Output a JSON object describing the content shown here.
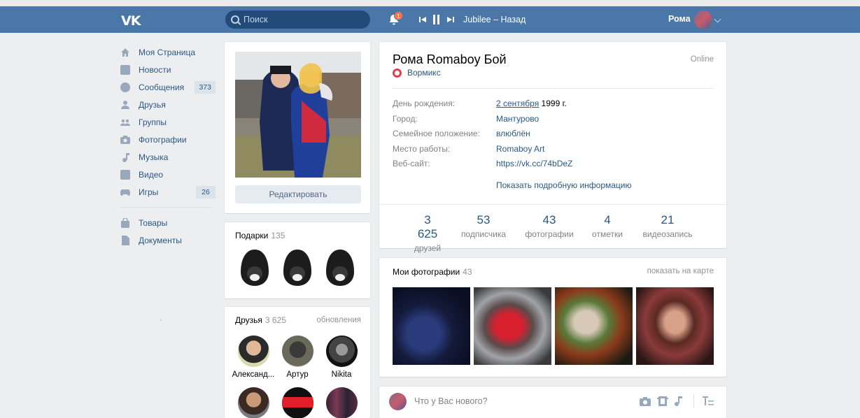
{
  "header": {
    "logo": "VK",
    "search_placeholder": "Поиск",
    "notifications_count": "1",
    "track": "Jubilee – Назад",
    "user_name": "Рома"
  },
  "sidebar": {
    "items": [
      {
        "label": "Моя Страница",
        "icon": "home-icon"
      },
      {
        "label": "Новости",
        "icon": "news-icon"
      },
      {
        "label": "Сообщения",
        "icon": "messages-icon",
        "count": "373"
      },
      {
        "label": "Друзья",
        "icon": "friend-icon"
      },
      {
        "label": "Группы",
        "icon": "groups-icon"
      },
      {
        "label": "Фотографии",
        "icon": "camera-icon"
      },
      {
        "label": "Музыка",
        "icon": "music-icon"
      },
      {
        "label": "Видео",
        "icon": "video-icon"
      },
      {
        "label": "Игры",
        "icon": "games-icon",
        "count": "26"
      }
    ],
    "extra": [
      {
        "label": "Товары",
        "icon": "bag-icon"
      },
      {
        "label": "Документы",
        "icon": "document-icon"
      }
    ]
  },
  "avatar_card": {
    "edit_label": "Редактировать"
  },
  "gifts": {
    "title": "Подарки",
    "count": "135"
  },
  "friends": {
    "title": "Друзья",
    "count": "3 625",
    "updates": "обновления",
    "items": [
      {
        "name": "Александ..."
      },
      {
        "name": "Артур"
      },
      {
        "name": "Nikita"
      }
    ]
  },
  "profile": {
    "name": "Рома Romaboy Бой",
    "online": "Online",
    "status": "Вормикс",
    "info": [
      {
        "key": "День рождения:",
        "value_link": "2 сентября",
        "value_rest": " 1999 г."
      },
      {
        "key": "Город:",
        "value": "Мантурово"
      },
      {
        "key": "Семейное положение:",
        "value": "влюблён"
      },
      {
        "key": "Место работы:",
        "value": "Romaboy Art"
      },
      {
        "key": "Веб-сайт:",
        "value": "https://vk.cc/74bDeZ"
      }
    ],
    "more": "Показать подробную информацию",
    "stats": [
      {
        "n": "3 625",
        "l": "друзей"
      },
      {
        "n": "53",
        "l": "подписчика"
      },
      {
        "n": "43",
        "l": "фотографии"
      },
      {
        "n": "4",
        "l": "отметки"
      },
      {
        "n": "21",
        "l": "видеозапись"
      }
    ]
  },
  "photos": {
    "title": "Мои фотографии",
    "count": "43",
    "map_link": "показать на карте"
  },
  "post": {
    "placeholder": "Что у Вас нового?"
  },
  "colors": {
    "header": "#4a76a8",
    "link": "#2a5885",
    "background": "#edeef0"
  }
}
